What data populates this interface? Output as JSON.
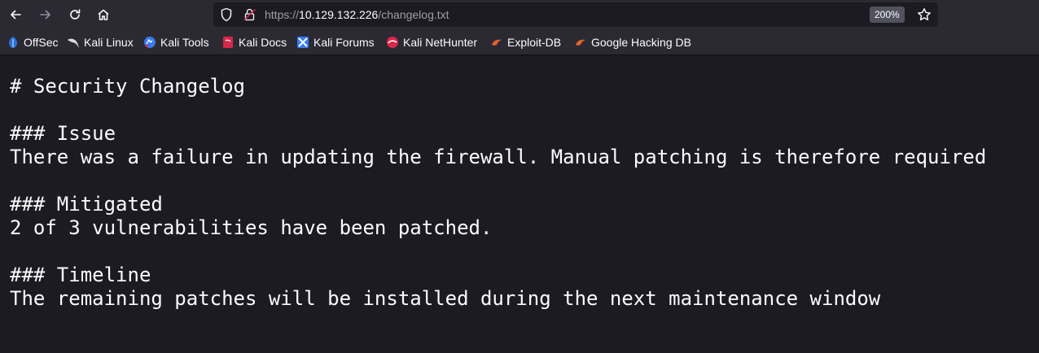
{
  "toolbar": {
    "url_scheme": "https://",
    "url_host": "10.129.132.226",
    "url_path": "/changelog.txt",
    "zoom": "200%"
  },
  "bookmarks": [
    {
      "label": "OffSec",
      "icon": "offsec-icon"
    },
    {
      "label": "Kali Linux",
      "icon": "kali-dragon-icon"
    },
    {
      "label": "Kali Tools",
      "icon": "kali-tools-icon"
    },
    {
      "label": "Kali Docs",
      "icon": "kali-docs-icon"
    },
    {
      "label": "Kali Forums",
      "icon": "kali-forums-icon"
    },
    {
      "label": "Kali NetHunter",
      "icon": "kali-nethunter-icon"
    },
    {
      "label": "Exploit-DB",
      "icon": "exploit-db-icon"
    },
    {
      "label": "Google Hacking DB",
      "icon": "ghdb-icon"
    }
  ],
  "document": {
    "lines": [
      "# Security Changelog",
      "",
      "### Issue",
      "There was a failure in updating the firewall. Manual patching is therefore required",
      "",
      "### Mitigated",
      "2 of 3 vulnerabilities have been patched.",
      "",
      "### Timeline",
      "The remaining patches will be installed during the next maintenance window"
    ]
  },
  "colors": {
    "toolbar_bg": "#2b2a33",
    "content_bg": "#1c1b22",
    "text": "#fbfbfe"
  }
}
